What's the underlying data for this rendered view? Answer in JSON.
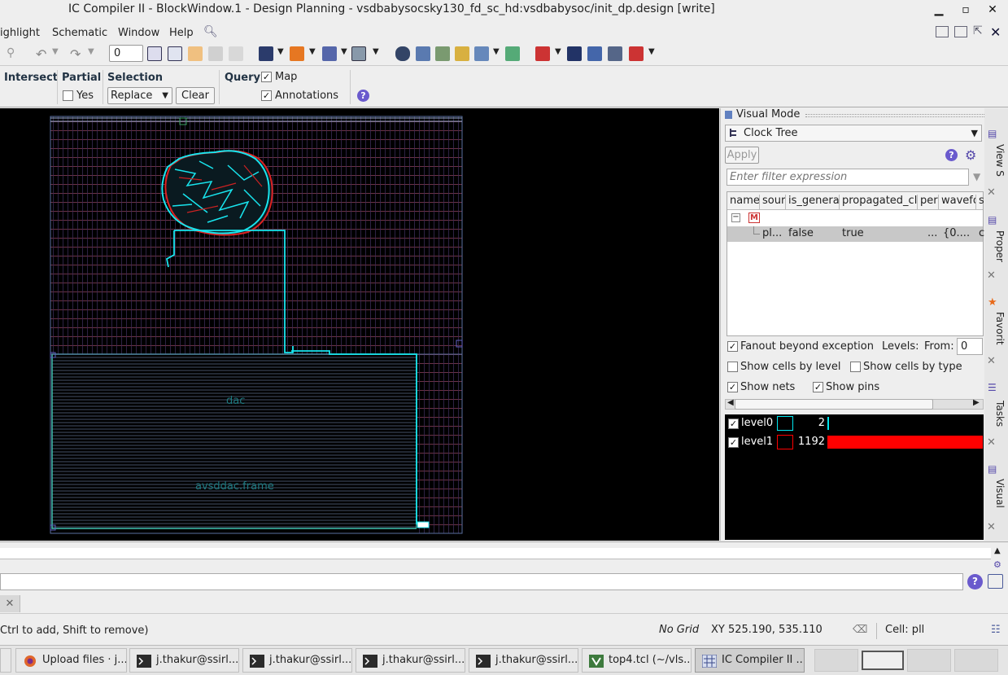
{
  "window": {
    "title": "IC Compiler II - BlockWindow.1 - Design Planning - vsdbabysocsky130_fd_sc_hd:vsdbabysoc/init_dp.design [write]",
    "minimize": "▪",
    "maximize": "▫",
    "close": "✕"
  },
  "menu": [
    "ighlight",
    "Schematic",
    "Window",
    "Help"
  ],
  "toolbar": {
    "spin_value": "0"
  },
  "options": {
    "intersect_label": "Intersect",
    "partial_label": "Partial",
    "partial_yes": "Yes",
    "selection_label": "Selection",
    "selection_value": "Replace",
    "clear_label": "Clear",
    "query_label": "Query",
    "map_label": "Map",
    "annotations_label": "Annotations",
    "help": "?"
  },
  "canvas": {
    "labels": [
      "dac",
      "avsddac.frame"
    ]
  },
  "panel": {
    "header": "Visual Mode",
    "mode": "Clock Tree",
    "apply": "Apply",
    "filter_placeholder": "Enter filter expression",
    "columns": [
      "name",
      "sour",
      "is_genera",
      "propagated_cl",
      "per",
      "wavefo",
      "s"
    ],
    "tree_root": "M",
    "row": {
      "name": "pl...",
      "is_generated": "false",
      "propagated": "true",
      "per": "...",
      "waveform": "{0....",
      "s": "c"
    },
    "fanout_label": "Fanout beyond exception",
    "levels_label": "Levels:",
    "from_label": "From:",
    "from_value": "0",
    "cells_by_level": "Show cells by level",
    "cells_by_type": "Show cells by type",
    "show_nets": "Show nets",
    "show_pins": "Show pins",
    "levels": [
      {
        "name": "level0",
        "count": "2",
        "color": "#00e5ee",
        "fill": 0.002
      },
      {
        "name": "level1",
        "count": "1192",
        "color": "#ff0000",
        "fill": 1.0
      }
    ]
  },
  "side_tabs": [
    "View S",
    "Proper",
    "Favorit",
    "Tasks",
    "Visual"
  ],
  "status": {
    "hint": "Ctrl to add, Shift to remove)",
    "grid": "No Grid",
    "xy": "XY 525.190, 535.110",
    "cell": "Cell: pll"
  },
  "taskbar": [
    {
      "label": "Upload files · j...",
      "icon": "firefox-icon"
    },
    {
      "label": "j.thakur@ssirl...",
      "icon": "terminal-icon"
    },
    {
      "label": "j.thakur@ssirl...",
      "icon": "terminal-icon"
    },
    {
      "label": "j.thakur@ssirl...",
      "icon": "terminal-icon"
    },
    {
      "label": "j.thakur@ssirl...",
      "icon": "terminal-icon"
    },
    {
      "label": "top4.tcl (~/vls...",
      "icon": "editor-icon"
    },
    {
      "label": "IC Compiler II ...",
      "icon": "app-icon"
    }
  ]
}
